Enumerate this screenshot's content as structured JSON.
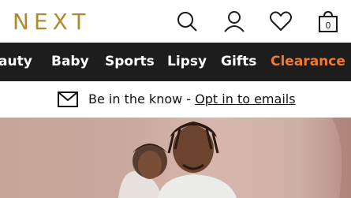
{
  "header": {
    "logo": "NEXT",
    "icons": [
      "search-icon",
      "account-icon",
      "favourites-icon",
      "bag-icon"
    ],
    "bag_count": "0"
  },
  "nav": {
    "items": [
      {
        "label": "auty",
        "highlight": false
      },
      {
        "label": "Baby",
        "highlight": false
      },
      {
        "label": "Sports",
        "highlight": false
      },
      {
        "label": "Lipsy",
        "highlight": false
      },
      {
        "label": "Gifts",
        "highlight": false
      },
      {
        "label": "Clearance",
        "highlight": true
      }
    ]
  },
  "promo": {
    "text": "Be in the know - ",
    "link": "Opt in to emails",
    "icon": "envelope-icon"
  },
  "colors": {
    "brand_gold": "#b08a2c",
    "nav_bg": "#1d1d1d",
    "clearance": "#ef7a34"
  }
}
